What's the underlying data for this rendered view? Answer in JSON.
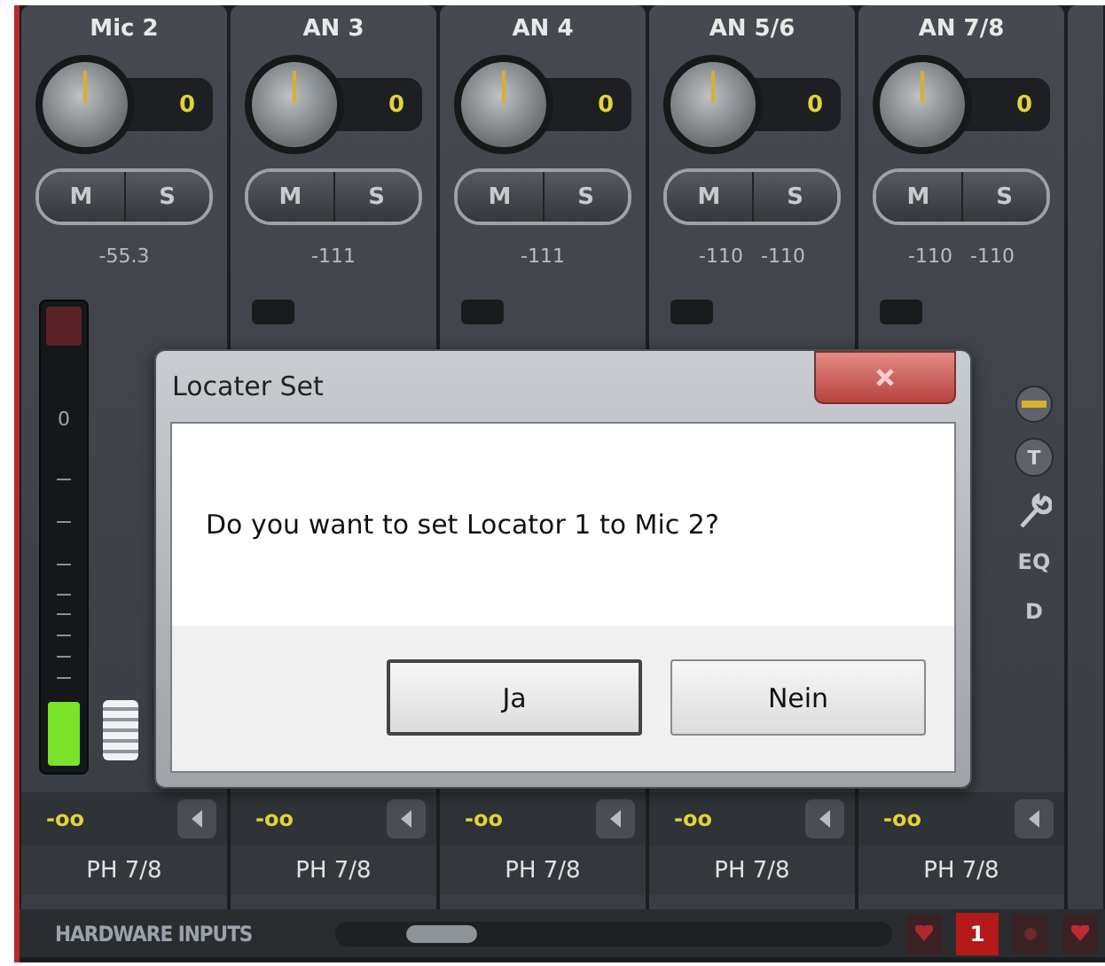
{
  "channels": [
    {
      "name": "Mic 2",
      "gain": "0",
      "mute": "M",
      "solo": "S",
      "readings": [
        "-55.3"
      ],
      "fader_value": "-oo",
      "output": "PH 7/8",
      "kind": "meter"
    },
    {
      "name": "AN 3",
      "gain": "0",
      "mute": "M",
      "solo": "S",
      "readings": [
        "-111"
      ],
      "fader_value": "-oo",
      "output": "PH 7/8",
      "kind": "plain"
    },
    {
      "name": "AN 4",
      "gain": "0",
      "mute": "M",
      "solo": "S",
      "readings": [
        "-111"
      ],
      "fader_value": "-oo",
      "output": "PH 7/8",
      "kind": "plain"
    },
    {
      "name": "AN 5/6",
      "gain": "0",
      "mute": "M",
      "solo": "S",
      "readings": [
        "-110",
        "-110"
      ],
      "fader_value": "-oo",
      "output": "PH 7/8",
      "kind": "plain"
    },
    {
      "name": "AN 7/8",
      "gain": "0",
      "mute": "M",
      "solo": "S",
      "readings": [
        "-110",
        "-110"
      ],
      "fader_value": "-oo",
      "output": "PH 7/8",
      "kind": "tools"
    }
  ],
  "meter": {
    "scale_label": "0",
    "level": 0.14
  },
  "tool_labels": [
    "T",
    "EQ",
    "D"
  ],
  "dialog": {
    "title": "Locater Set",
    "message": "Do you want to set Locator 1 to Mic 2?",
    "buttons": [
      {
        "label": "Ja",
        "default": true
      },
      {
        "label": "Nein",
        "default": false
      }
    ]
  },
  "footer": {
    "label": "HARDWARE INPUTS",
    "page": "1"
  }
}
